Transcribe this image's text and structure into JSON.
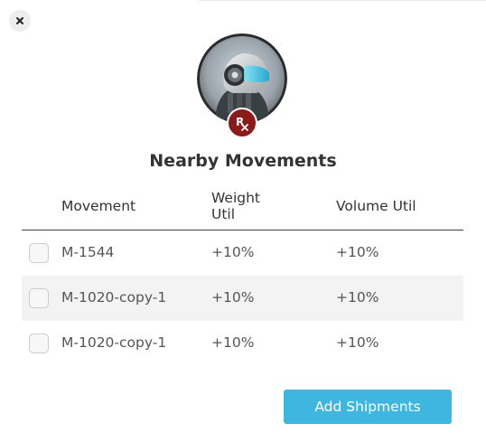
{
  "dialog": {
    "close_icon": "close-icon",
    "title": "Nearby Movements",
    "avatar_icon": "robot-head-avatar",
    "badge_label": "Rx"
  },
  "table": {
    "headers": {
      "movement": "Movement",
      "weight_line1": "Weight",
      "weight_line2": "Util",
      "volume": "Volume Util"
    },
    "rows": [
      {
        "movement": "M-1544",
        "weight_util": "+10%",
        "volume_util": "+10%",
        "checked": false
      },
      {
        "movement": "M-1020-copy-1",
        "weight_util": "+10%",
        "volume_util": "+10%",
        "checked": false
      },
      {
        "movement": "M-1020-copy-1",
        "weight_util": "+10%",
        "volume_util": "+10%",
        "checked": false
      }
    ]
  },
  "actions": {
    "add_shipments_label": "Add Shipments"
  },
  "colors": {
    "accent": "#3fb6e0",
    "badge": "#8b1a1a",
    "alt_row": "#f3f3f3"
  }
}
